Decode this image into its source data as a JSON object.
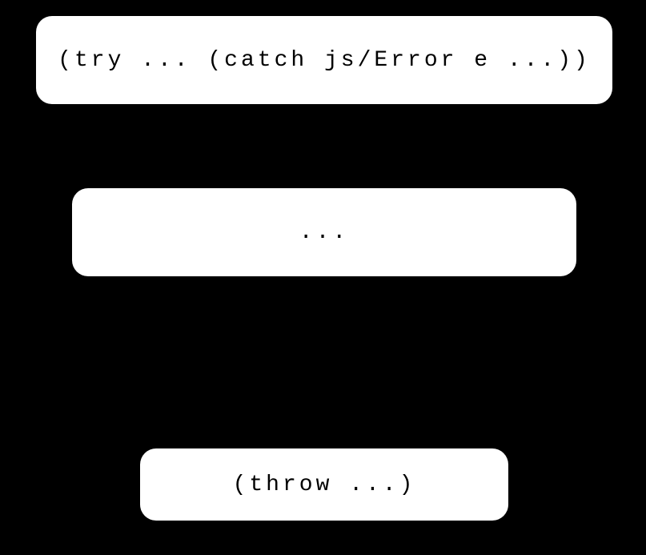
{
  "diagram": {
    "box_top": "(try ... (catch js/Error e ...))",
    "box_mid": "...",
    "box_bot": "(throw ...)"
  }
}
